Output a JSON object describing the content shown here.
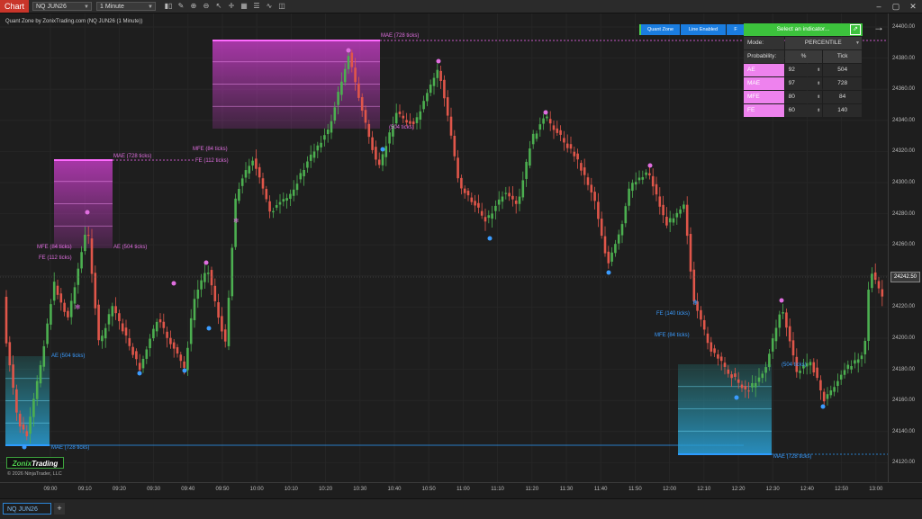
{
  "toolbar": {
    "chart_label": "Chart",
    "instrument": "NQ JUN26",
    "interval": "1 Minute",
    "icons": [
      "bar-chart-icon",
      "draw-tool-icon",
      "zoom-in-icon",
      "zoom-out-icon",
      "pointer-icon",
      "crosshair-icon",
      "data-box-icon",
      "properties-icon",
      "indicators-icon",
      "strategies-icon"
    ]
  },
  "chart_title": "Quant Zone by ZonixTrading.com (NQ JUN26 (1 Minute))",
  "logo": {
    "brand": "Zonix",
    "brand2": "Trading"
  },
  "copyright": "© 2026 NinjaTrader, LLC",
  "buttons": {
    "quant_zone": "Quant Zone",
    "line_enabled": "Line Enabled",
    "f": "F"
  },
  "panel": {
    "select_label": "Select an indicator...",
    "mode_label": "Mode:",
    "mode_value": "PERCENTILE",
    "prob_label": "Probability:",
    "col_pct": "%",
    "col_tick": "Tick",
    "rows": [
      {
        "name": "AE",
        "pct": "92",
        "tick": "504"
      },
      {
        "name": "MAE",
        "pct": "97",
        "tick": "728"
      },
      {
        "name": "MFE",
        "pct": "80",
        "tick": "84"
      },
      {
        "name": "FE",
        "pct": "60",
        "tick": "140"
      }
    ]
  },
  "last_price": "24242.50",
  "y_labels": [
    "24400.00",
    "24380.00",
    "24360.00",
    "24340.00",
    "24320.00",
    "24300.00",
    "24280.00",
    "24260.00",
    "24240.00",
    "24220.00",
    "24200.00",
    "24180.00",
    "24160.00",
    "24140.00",
    "24120.00"
  ],
  "x_labels": [
    "09:00",
    "09:10",
    "09:20",
    "09:30",
    "09:40",
    "09:50",
    "10:00",
    "10:10",
    "10:20",
    "10:30",
    "10:40",
    "10:50",
    "11:00",
    "11:10",
    "11:20",
    "11:30",
    "11:40",
    "11:50",
    "12:00",
    "12:10",
    "12:20",
    "12:30",
    "12:40",
    "12:50",
    "13:00"
  ],
  "zone_labels": {
    "z1_mae": "MAE (728 ticks)",
    "z1_mfe": "MFE (84 ticks)",
    "z1_ae": "AE (504 ticks)",
    "z1_fe": "FE (112 ticks)",
    "z2_mae": "MAE (728 ticks)",
    "z2_mfe": "MFE (84 ticks)",
    "z2_fe": "FE (112 ticks)",
    "z2_ae": "(504 ticks)",
    "z3_ae": "AE (504 ticks)",
    "z3_mae": "MAE (728 ticks)",
    "z4_fe": "FE (140 ticks)",
    "z4_mfe": "MFE (84 ticks)",
    "z4_ae": "(504 ticks)",
    "z4_mae": "MAE (728 ticks)"
  },
  "tab": {
    "label": "NQ JUN26",
    "add": "+"
  },
  "colors": {
    "up": "#4caf50",
    "down": "#e0564a",
    "pink": "#e06ee0",
    "blue": "#3b9cff",
    "accent_green": "#3cc23c"
  }
}
